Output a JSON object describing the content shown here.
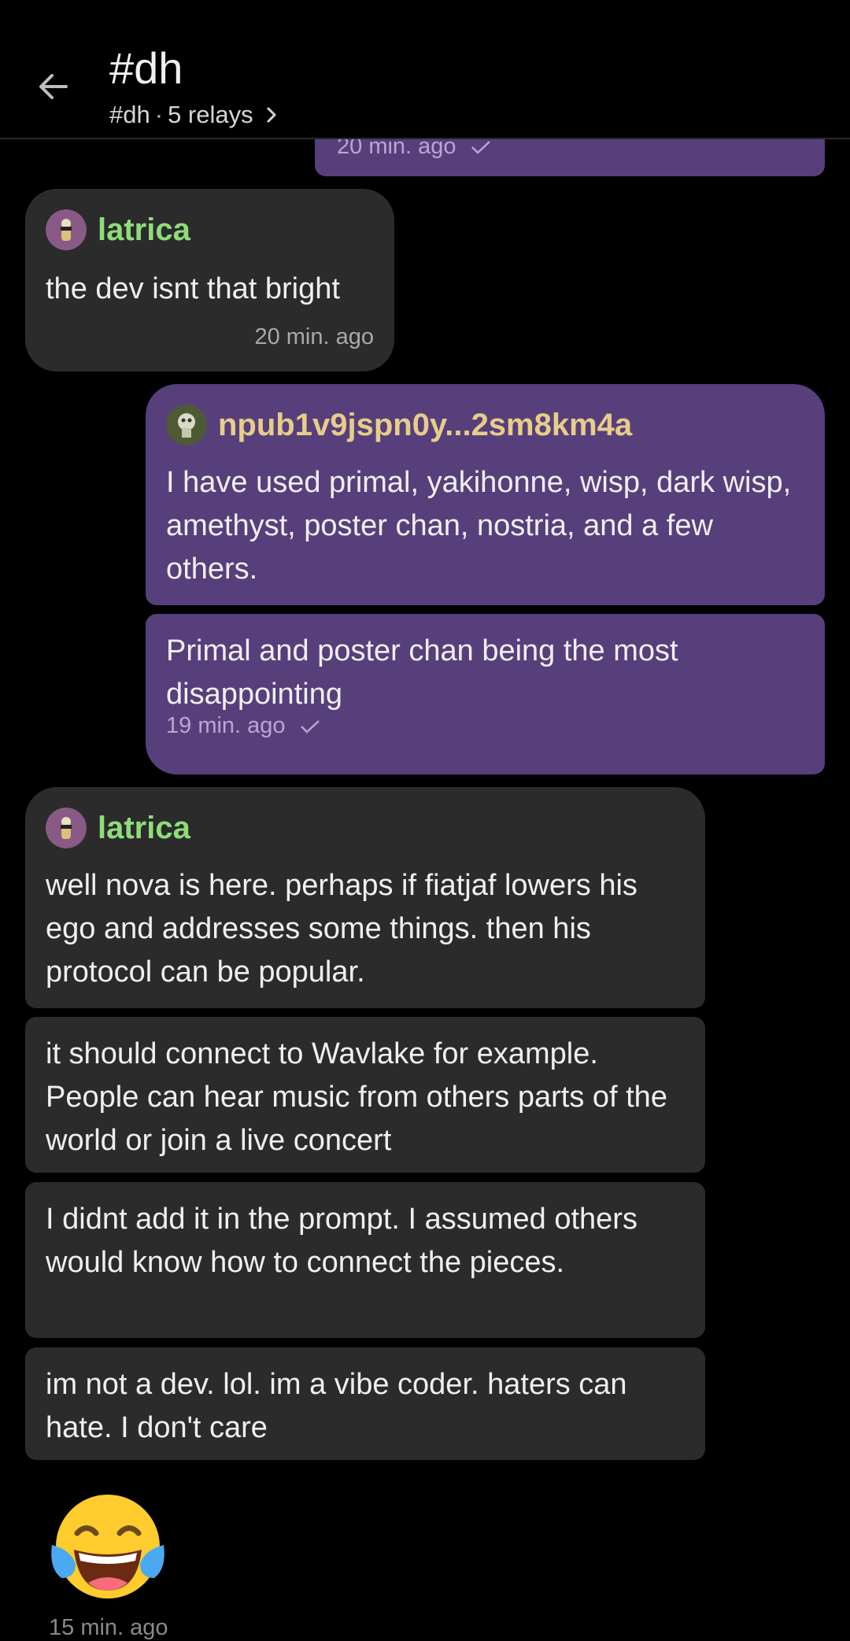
{
  "header": {
    "title": "#dh",
    "subtitle_tag": "#dh",
    "subtitle_separator": "·",
    "subtitle_relays": "5 relays"
  },
  "messages": [
    {
      "time": "20 min. ago"
    },
    {
      "author": "latrica",
      "text": "the dev isnt that bright",
      "time": "20 min. ago"
    },
    {
      "author": "npub1v9jspn0y...2sm8km4a",
      "text": "I have used primal, yakihonne, wisp, dark wisp, amethyst, poster chan, nostria, and a few others."
    },
    {
      "text": "Primal and poster chan being the most disappointing",
      "time": "19 min. ago"
    },
    {
      "author": "latrica",
      "text": "well nova is here. perhaps if fiatjaf lowers his ego and addresses some things. then his  protocol can be popular."
    },
    {
      "text": "it should connect to Wavlake for example. People can hear music from others parts of the world or join a live concert"
    },
    {
      "text": "I didnt add it in the prompt. I assumed others would know how to connect the pieces."
    },
    {
      "text": "im not a dev. lol. im a vibe coder. haters can hate. I don't care"
    },
    {
      "emoji": "face-with-tears-of-joy",
      "time": "15 min. ago"
    }
  ],
  "colors": {
    "background": "#000000",
    "their_bubble": "#2b2b2b",
    "my_bubble": "#573f7c",
    "author_green": "#8fdc7a",
    "author_gold": "#e7cd88"
  },
  "icons": [
    "back-arrow-icon",
    "chevron-right-icon",
    "check-icon",
    "avatar-icon"
  ]
}
